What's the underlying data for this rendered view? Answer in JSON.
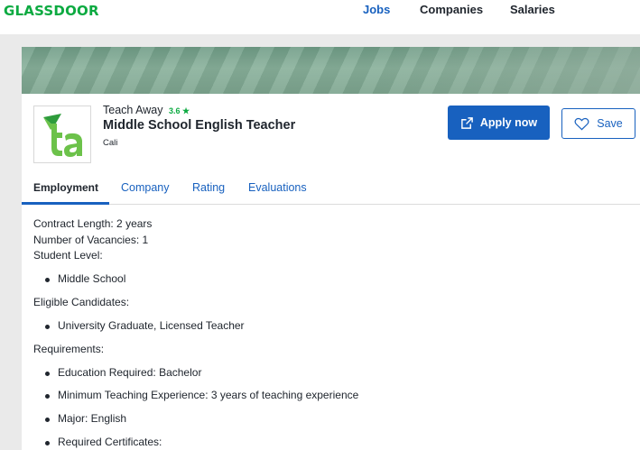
{
  "header": {
    "logo_text": "GLASSDOOR",
    "nav": [
      {
        "label": "Jobs"
      },
      {
        "label": "Companies"
      },
      {
        "label": "Salaries"
      }
    ]
  },
  "job": {
    "company": "Teach Away",
    "rating": "3.6 ★",
    "title": "Middle School English Teacher",
    "location": "Cali",
    "apply_label": "Apply now",
    "save_label": "Save",
    "logo_text": "ta"
  },
  "tabs": [
    {
      "label": "Employment"
    },
    {
      "label": "Company"
    },
    {
      "label": "Rating"
    },
    {
      "label": "Evaluations"
    }
  ],
  "details": {
    "contract_length": "Contract Length: 2 years",
    "vacancies": "Number of Vacancies: 1",
    "student_level_label": "Student Level:",
    "student_level_items": [
      "Middle School"
    ],
    "eligible_label": "Eligible Candidates:",
    "eligible_items": [
      "University Graduate, Licensed Teacher"
    ],
    "requirements_label": "Requirements:",
    "requirements_items": [
      "Education Required: Bachelor",
      "Minimum Teaching Experience: 3 years of teaching experience",
      "Major: English",
      "Required Certificates:"
    ]
  },
  "colors": {
    "brand_green": "#0caa41",
    "primary_blue": "#1861bf"
  }
}
